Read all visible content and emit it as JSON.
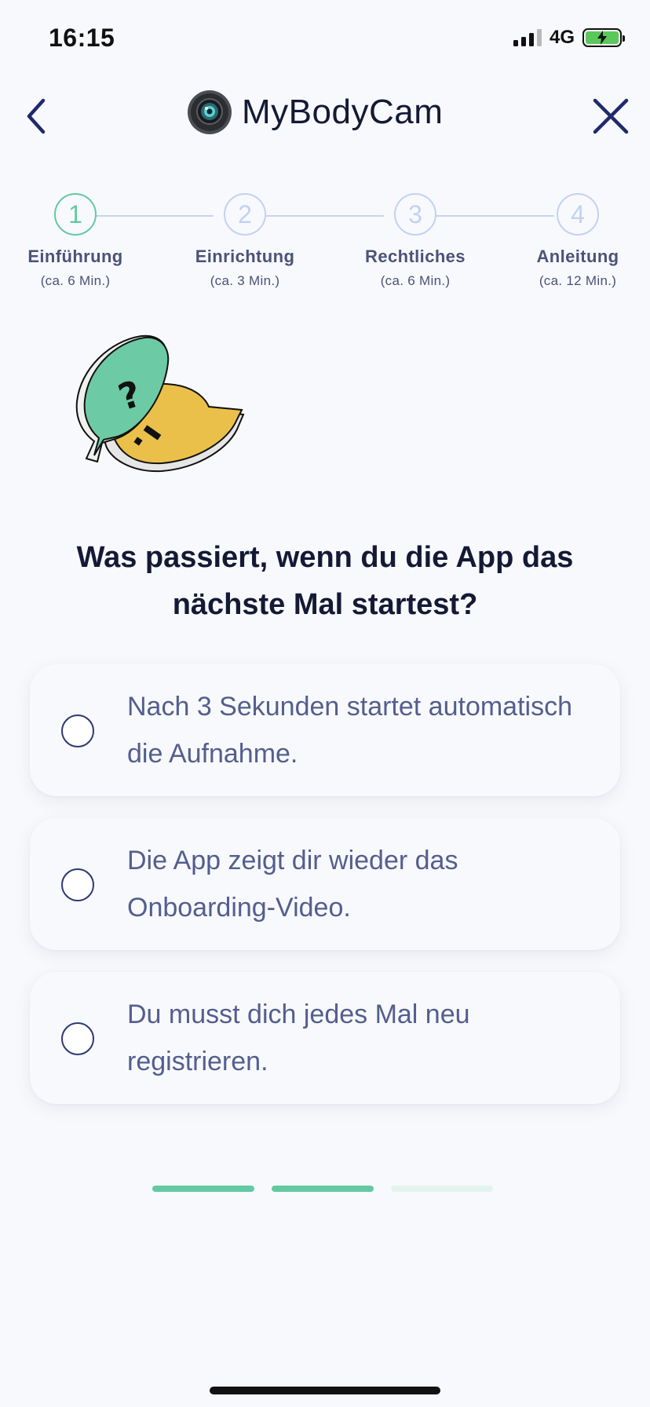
{
  "status_bar": {
    "time": "16:15",
    "network": "4G",
    "battery_charging": true,
    "battery_color": "#5ac85b"
  },
  "header": {
    "brand_name": "MyBodyCam",
    "back_icon": "chevron-left-icon",
    "close_icon": "close-icon"
  },
  "stepper": {
    "steps": [
      {
        "number": "1",
        "label": "Einführung",
        "duration": "(ca. 6 Min.)",
        "active": true
      },
      {
        "number": "2",
        "label": "Einrichtung",
        "duration": "(ca. 3 Min.)",
        "active": false
      },
      {
        "number": "3",
        "label": "Rechtliches",
        "duration": "(ca. 6 Min.)",
        "active": false
      },
      {
        "number": "4",
        "label": "Anleitung",
        "duration": "(ca. 12 Min.)",
        "active": false
      }
    ],
    "active_color": "#64c9a2",
    "inactive_color": "#c3d1f4"
  },
  "quiz": {
    "question": "Was passiert, wenn du die App das nächste Mal startest?",
    "answers": [
      {
        "text": "Nach 3 Sekunden startet automatisch die Aufnahme.",
        "selected": false
      },
      {
        "text": "Die App zeigt dir wieder das Onboarding-Video.",
        "selected": false
      },
      {
        "text": "Du musst dich jedes Mal neu registrieren.",
        "selected": false
      }
    ]
  },
  "progress": {
    "total_segments": 3,
    "completed_segments": 2
  }
}
